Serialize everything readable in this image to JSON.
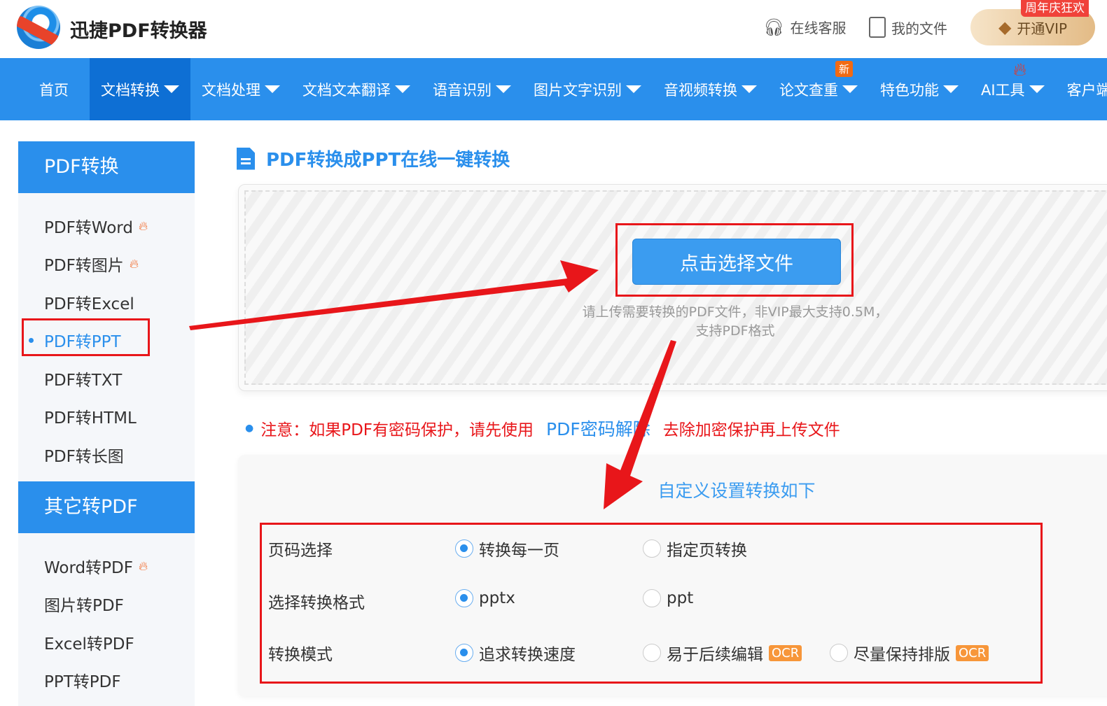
{
  "header": {
    "app_title": "迅捷PDF转换器",
    "service": "在线客服",
    "my_files": "我的文件",
    "vip": "开通VIP",
    "vip_badge": "周年庆狂欢"
  },
  "nav": {
    "items": [
      {
        "label": "首页"
      },
      {
        "label": "文档转换"
      },
      {
        "label": "文档处理"
      },
      {
        "label": "文档文本翻译"
      },
      {
        "label": "语音识别"
      },
      {
        "label": "图片文字识别"
      },
      {
        "label": "音视频转换"
      },
      {
        "label": "论文查重",
        "badge": "新"
      },
      {
        "label": "特色功能"
      },
      {
        "label": "AI工具"
      },
      {
        "label": "客户端"
      }
    ]
  },
  "sidebar": {
    "section1": "PDF转换",
    "items1": [
      "PDF转Word",
      "PDF转图片",
      "PDF转Excel",
      "PDF转PPT",
      "PDF转TXT",
      "PDF转HTML",
      "PDF转长图"
    ],
    "section2": "其它转PDF",
    "items2": [
      "Word转PDF",
      "图片转PDF",
      "Excel转PDF",
      "PPT转PDF"
    ]
  },
  "main": {
    "title": "PDF转换成PPT在线一键转换",
    "upload_button": "点击选择文件",
    "hint_line1": "请上传需要转换的PDF文件，非VIP最大支持0.5M，",
    "hint_line2": "支持PDF格式",
    "notice_prefix": "注意：如果PDF有密码保护，请先使用",
    "notice_link": "PDF密码解除",
    "notice_suffix": "去除加密保护再上传文件"
  },
  "settings": {
    "title": "自定义设置转换如下",
    "rows": [
      {
        "label": "页码选择",
        "options": [
          "转换每一页",
          "指定页转换"
        ]
      },
      {
        "label": "选择转换格式",
        "options": [
          "pptx",
          "ppt"
        ]
      },
      {
        "label": "转换模式",
        "options": [
          "追求转换速度",
          "易于后续编辑",
          "尽量保持排版"
        ],
        "ocr": "OCR"
      }
    ]
  },
  "colors": {
    "primary": "#2a8fec",
    "annotation": "#e8161a"
  }
}
